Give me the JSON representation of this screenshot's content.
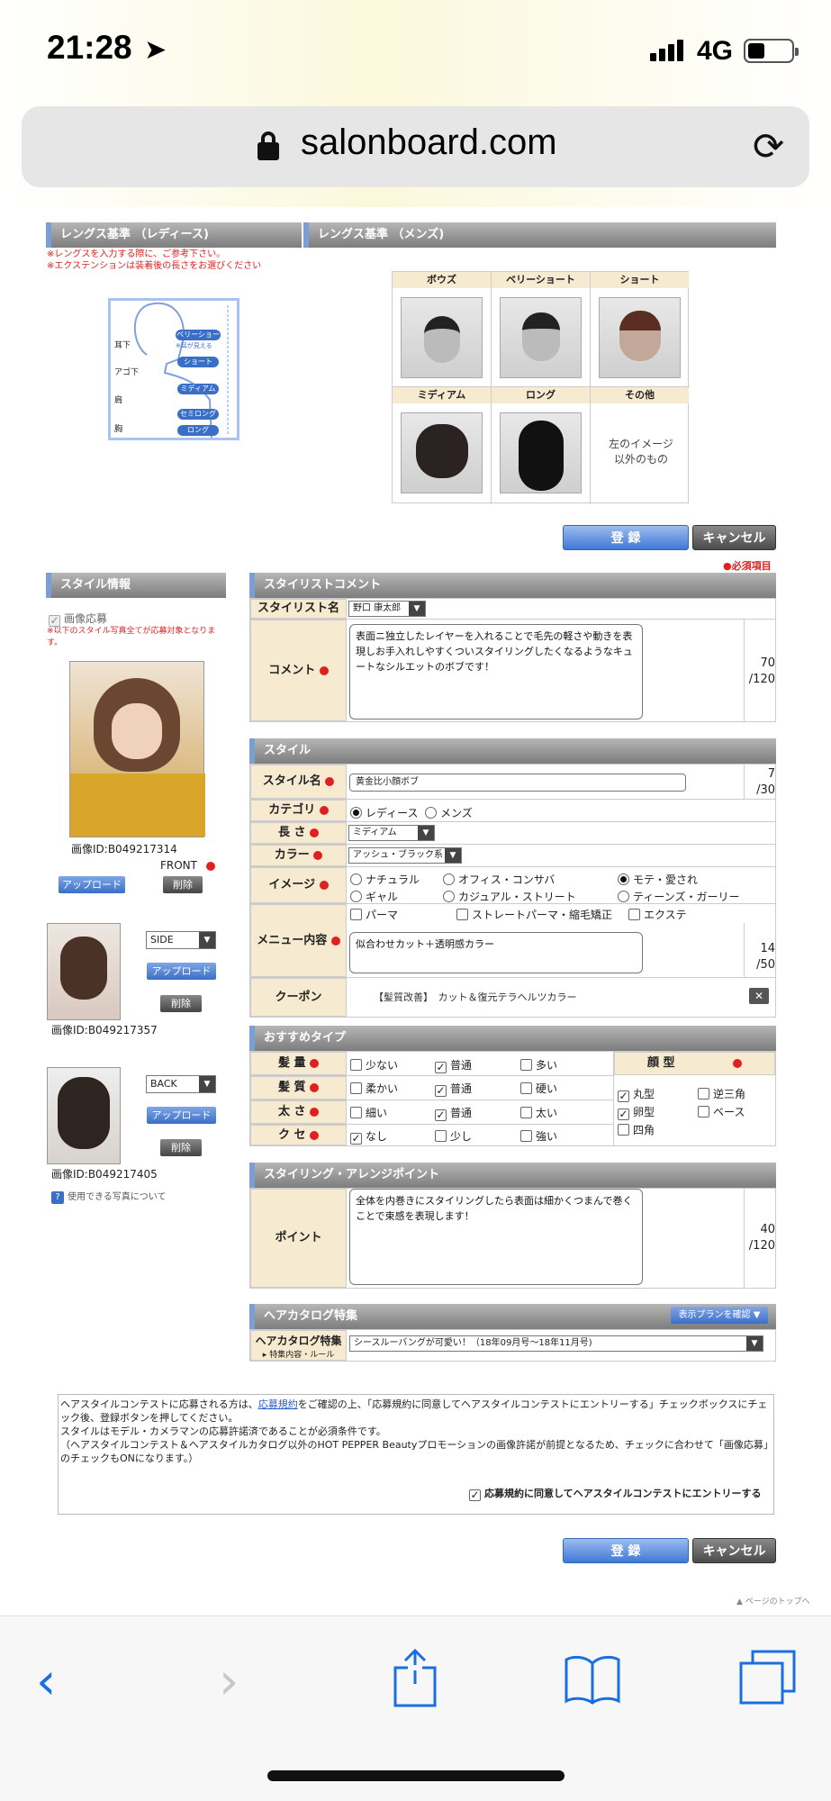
{
  "status": {
    "time": "21:28",
    "network": "4G"
  },
  "browser": {
    "url": "salonboard.com"
  },
  "length_guide": {
    "ladies_header": "レングス基準 （レディース)",
    "mens_header": "レングス基準 （メンズ)",
    "note1": "※レングスを入力する際に、ご参考下さい。",
    "note2": "※エクステンションは装着後の長さをお選びください",
    "body_marks": [
      "耳下",
      "アゴ下",
      "肩",
      "胸"
    ],
    "ladies_labels": [
      "ベリーショート",
      "※耳が見える",
      "ショート",
      "ミディアム",
      "セミロング",
      "ロング"
    ],
    "mens_cells": [
      {
        "label": "ボウズ"
      },
      {
        "label": "ベリーショート"
      },
      {
        "label": "ショート"
      },
      {
        "label": "ミディアム"
      },
      {
        "label": "ロング"
      },
      {
        "label": "その他",
        "text": "左のイメージ以外のもの"
      }
    ]
  },
  "actions": {
    "register": "登 録",
    "cancel": "キャンセル",
    "required": "●必須項目"
  },
  "style_info": {
    "header": "スタイル情報",
    "image_entry": "画像応募",
    "note": "※以下のスタイル写真全てが応募対象となります。",
    "front": {
      "id": "画像ID:B049217314",
      "label": "FRONT"
    },
    "side": {
      "id": "画像ID:B049217357",
      "select": "SIDE"
    },
    "back": {
      "id": "画像ID:B049217405",
      "select": "BACK"
    },
    "upload": "アップロード",
    "delete": "削除",
    "help": "使用できる写真について"
  },
  "stylist_comment": {
    "header": "スタイリストコメント",
    "stylist_label": "スタイリスト名",
    "stylist_value": "野口 康太郎",
    "comment_label": "コメント",
    "comment_value": "表面ニ独立したレイヤーを入れることで毛先の軽さや動きを表現しお手入れしやすくついスタイリングしたくなるようなキュートなシルエットのボブです！",
    "comment_count": "70",
    "comment_max": "/120"
  },
  "style": {
    "header": "スタイル",
    "name_label": "スタイル名",
    "name_value": "黄金比小顔ボブ",
    "name_count": "7",
    "name_max": "/30",
    "category_label": "カテゴリ",
    "category_options": [
      "レディース",
      "メンズ"
    ],
    "length_label": "長 さ",
    "length_value": "ミディアム",
    "color_label": "カラー",
    "color_value": "アッシュ・ブラック系",
    "image_label": "イメージ",
    "image_options": [
      "ナチュラル",
      "オフィス・コンサバ",
      "モテ・愛され",
      "ギャル",
      "カジュアル・ストリート",
      "ティーンズ・ガーリー"
    ],
    "menu_label": "メニュー内容",
    "menu_options": [
      "パーマ",
      "ストレートパーマ・縮毛矯正",
      "エクステ"
    ],
    "menu_value": "似合わせカット＋透明感カラー",
    "menu_count": "14",
    "menu_max": "/50",
    "coupon_label": "クーポン",
    "coupon_value": "【髪質改善】　カット＆復元テラヘルツカラー"
  },
  "recommend": {
    "header": "おすすめタイプ",
    "rows": [
      {
        "label": "髪 量",
        "options": [
          "少ない",
          "普通",
          "多い"
        ]
      },
      {
        "label": "髪 質",
        "options": [
          "柔かい",
          "普通",
          "硬い"
        ]
      },
      {
        "label": "太 さ",
        "options": [
          "細い",
          "普通",
          "太い"
        ]
      },
      {
        "label": "ク セ",
        "options": [
          "なし",
          "少し",
          "強い"
        ]
      }
    ],
    "face_label": "顔 型",
    "face_options": [
      "丸型",
      "逆三角",
      "卵型",
      "ベース",
      "四角"
    ]
  },
  "styling": {
    "header": "スタイリング・アレンジポイント",
    "point_label": "ポイント",
    "point_value": "全体を内巻きにスタイリングしたら表面は細かくつまんで巻くことで束感を表現します！",
    "point_count": "40",
    "point_max": "/120"
  },
  "catalog": {
    "header": "ヘアカタログ特集",
    "plan_button": "表示プランを確認 ▼",
    "label": "ヘアカタログ特集",
    "rule_link": "特集内容・ルール",
    "value": "シースルーバングが可愛い！（18年09月号〜18年11月号)"
  },
  "contest": {
    "line1a": "ヘアスタイルコンテストに応募される方は、",
    "link": "応募規約",
    "line1b": "をご確認の上、「応募規約に同意してヘアスタイルコンテストにエントリーする」チェックボックスにチェック後、登録ボタンを押してください。",
    "line2": "スタイルはモデル・カメラマンの応募許諾済であることが必須条件です。",
    "line3": "（ヘアスタイルコンテスト＆ヘアスタイルカタログ以外のHOT PEPPER Beautyプロモーションの画像許諾が前提となるため、チェックに合わせて「画像応募」のチェックもONになります。）",
    "checkbox": "応募規約に同意してヘアスタイルコンテストにエントリーする"
  },
  "page_top": "ページのトップへ",
  "colors": {
    "accent_blue": "#3f78d6",
    "required_red": "#e02020",
    "label_bg": "#f6ead0",
    "ios_blue": "#1a6fe0"
  }
}
